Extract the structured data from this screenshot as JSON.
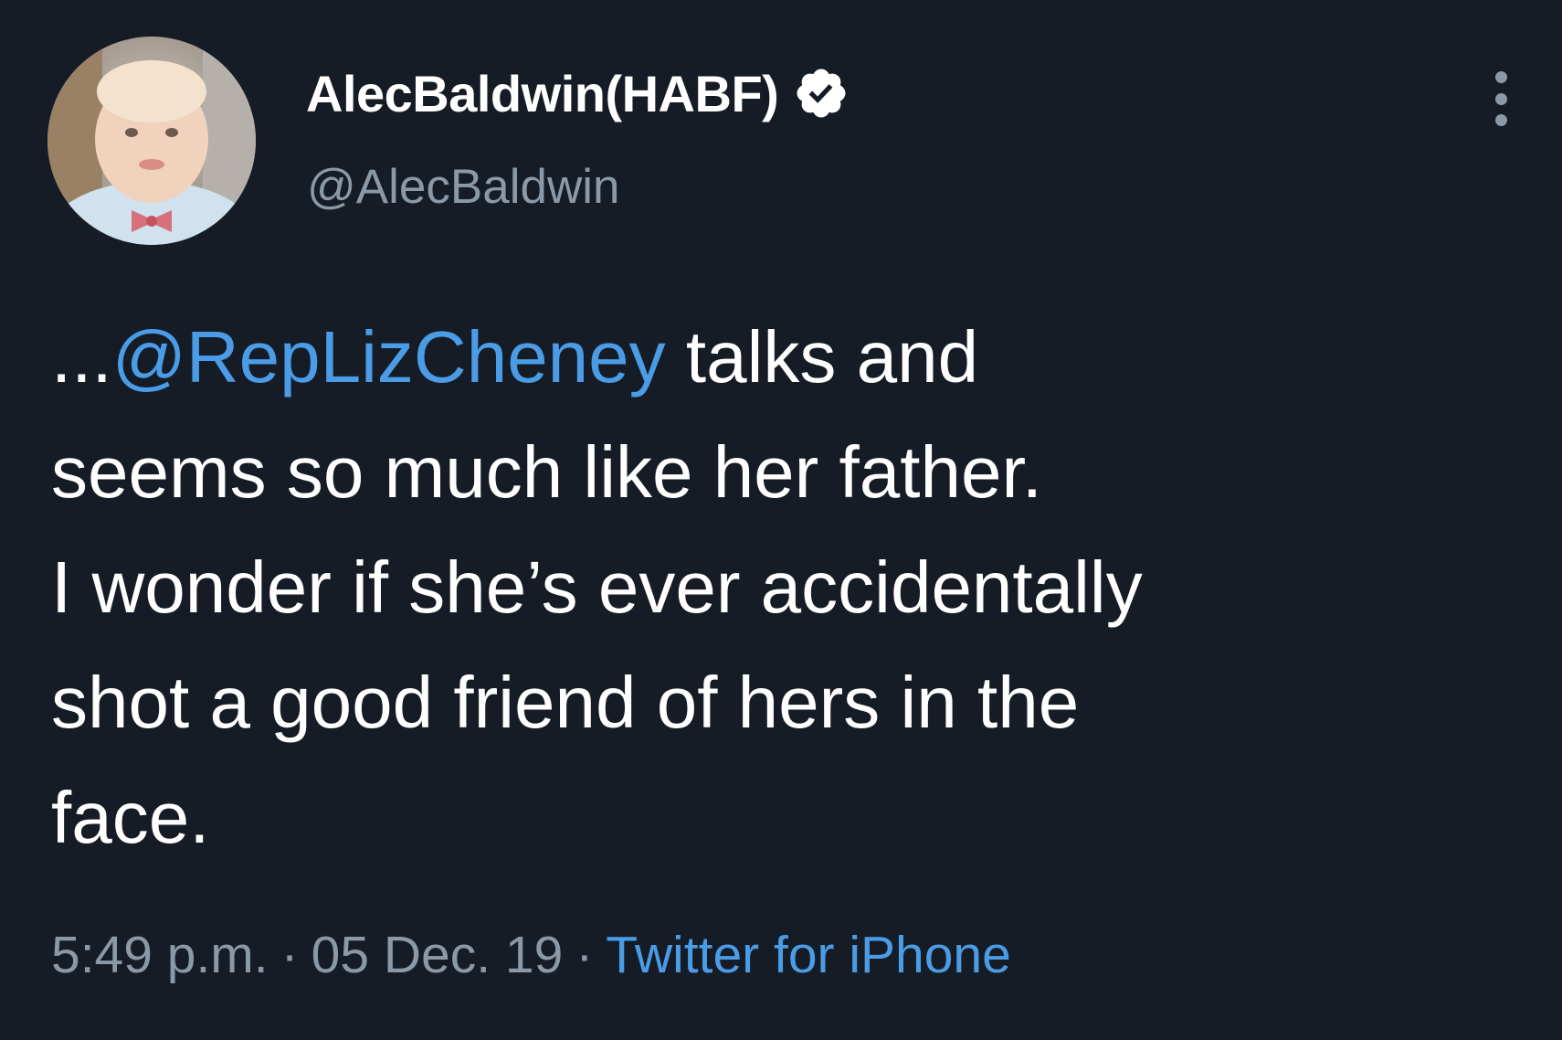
{
  "tweet": {
    "display_name": "AlecBaldwin(HABF)",
    "handle": "@AlecBaldwin",
    "verified_icon": "verified-badge-icon",
    "more_icon": "more-vertical-icon",
    "text": {
      "line1_prefix": "...",
      "mention": "@RepLizCheney",
      "line1_suffix": " talks and",
      "line2": "seems so much like her father.",
      "line3": "I wonder if she’s ever accidentally",
      "line4": "shot a good friend of hers in the",
      "line5": "face."
    },
    "meta": {
      "time": "5:49 p.m.",
      "separator": "·",
      "date": "05 Dec. 19",
      "source": "Twitter for iPhone"
    }
  },
  "colors": {
    "background": "#161c26",
    "text": "#ffffff",
    "secondary": "#8b98a5",
    "link": "#4a9ce6"
  }
}
